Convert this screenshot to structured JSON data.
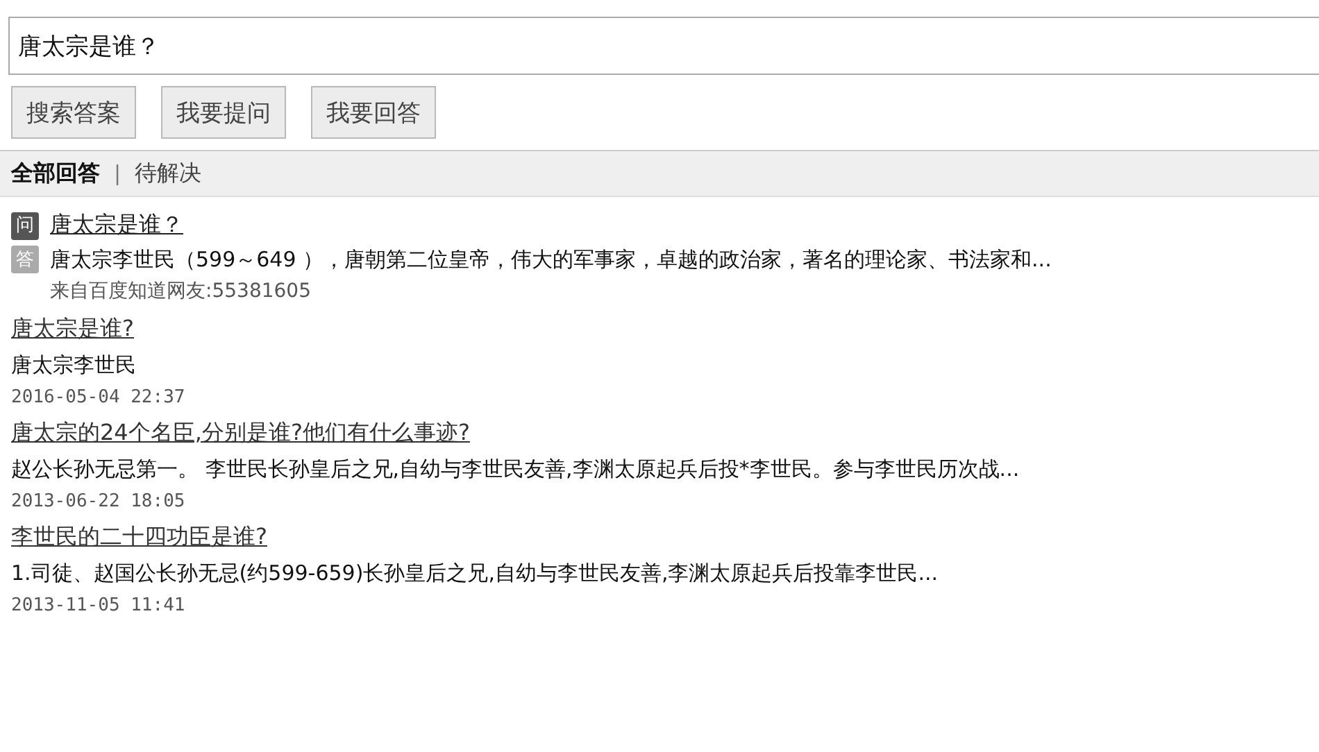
{
  "search": {
    "value": "唐太宗是谁？"
  },
  "buttons": [
    "搜索答案",
    "我要提问",
    "我要回答"
  ],
  "tabs": [
    {
      "label": "全部回答",
      "selected": true
    },
    {
      "label": "待解决",
      "selected": false
    }
  ],
  "tab_separator": "|",
  "featured": {
    "question_badge": "问",
    "question": "唐太宗是谁？",
    "answer_badge": "答",
    "answer": "唐太宗李世民（599～649 ），唐朝第二位皇帝，伟大的军事家，卓越的政治家，著名的理论家、书法家和...",
    "source": "来自百度知道网友:55381605"
  },
  "results": [
    {
      "title": "唐太宗是谁?",
      "snippet": "唐太宗李世民",
      "date": "2016-05-04 22:37"
    },
    {
      "title": "唐太宗的24个名臣,分别是谁?他们有什么事迹?",
      "snippet": "赵公长孙无忌第一。 李世民长孙皇后之兄,自幼与李世民友善,李渊太原起兵后投*李世民。参与李世民历次战...",
      "date": "2013-06-22 18:05"
    },
    {
      "title": "李世民的二十四功臣是谁?",
      "snippet": "1.司徒、赵国公长孙无忌(约599-659)长孙皇后之兄,自幼与李世民友善,李渊太原起兵后投靠李世民...",
      "date": "2013-11-05 11:41"
    }
  ]
}
